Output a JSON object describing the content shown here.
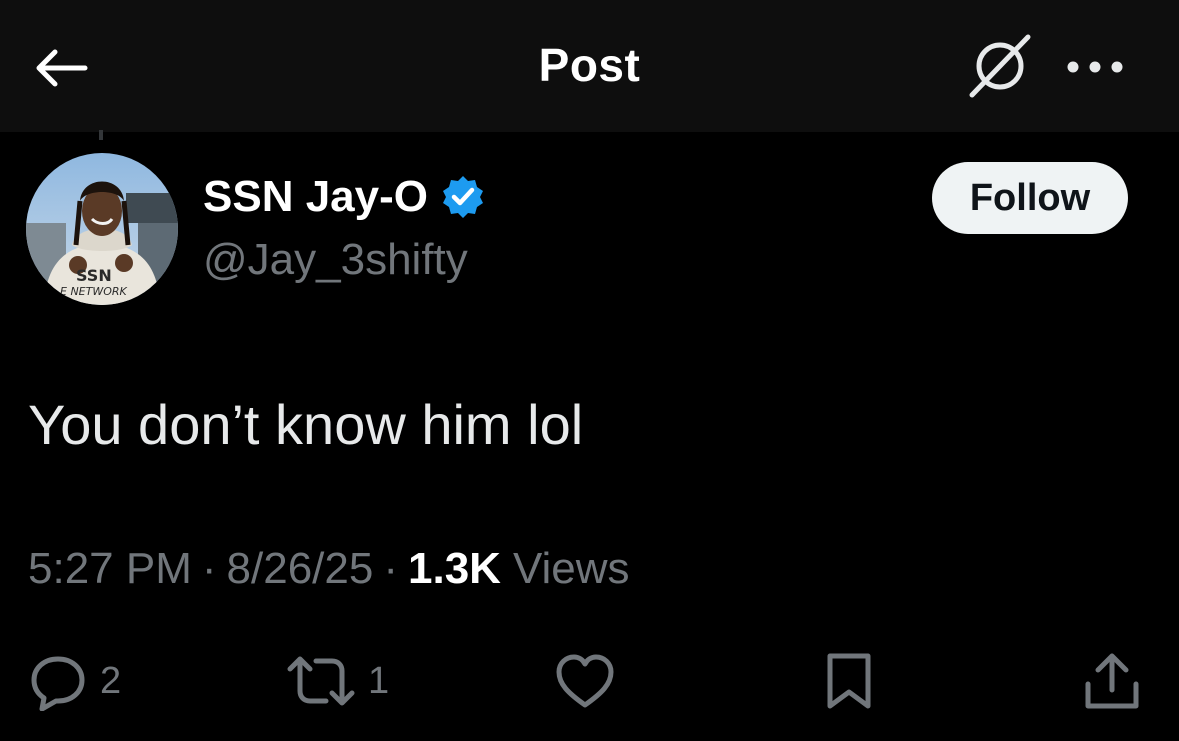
{
  "header": {
    "title": "Post",
    "back_icon": "arrow-left-icon",
    "grok_icon": "grok-icon",
    "more_icon": "more-horizontal-icon"
  },
  "author": {
    "display_name": "SSN Jay-O",
    "handle": "@Jay_3shifty",
    "verified": true,
    "verified_color": "#1d9bf0",
    "avatar_shirt_text": "E NETWORK"
  },
  "follow_button": {
    "label": "Follow"
  },
  "post": {
    "text": "You don’t know him lol"
  },
  "meta": {
    "time": "5:27 PM",
    "date": "8/26/25",
    "separator": "·",
    "views_count": "1.3K",
    "views_label": "Views"
  },
  "actions": {
    "reply_count": "2",
    "repost_count": "1",
    "reply_icon": "reply-icon",
    "repost_icon": "repost-icon",
    "like_icon": "heart-icon",
    "bookmark_icon": "bookmark-icon",
    "share_icon": "share-icon"
  },
  "colors": {
    "background": "#000000",
    "header_background": "#0e0e0e",
    "primary_text": "#e7e9ea",
    "secondary_text": "#71767b",
    "follow_button_bg": "#eff3f4"
  }
}
